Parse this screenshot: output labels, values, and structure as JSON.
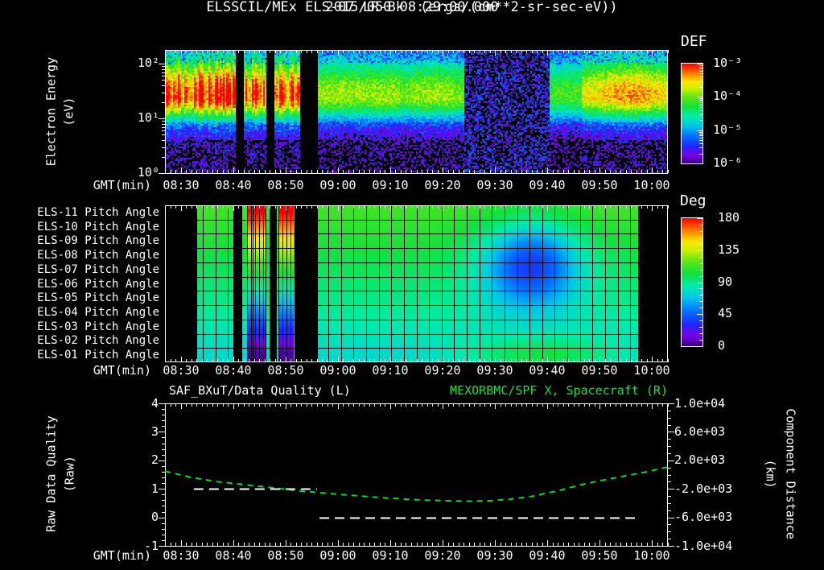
{
  "title": {
    "timestamp": "2015/050 08:29:00.000",
    "source": "ELSSCIL/MEx ELS-07 LR-Bk",
    "units": "(ergs/(cm**2-sr-sec-eV))"
  },
  "colors": {
    "background": "#000000",
    "text": "#ffffff",
    "accent_green": "#1ede3c",
    "tick": "#ffffff",
    "curve_green": "#00dd22",
    "quality_white": "#ffffff",
    "grid": "#000000"
  },
  "time_axis": {
    "label": "GMT(min)",
    "tick_labels": [
      "08:30",
      "08:40",
      "08:50",
      "09:00",
      "09:10",
      "09:20",
      "09:30",
      "09:40",
      "09:50",
      "10:00"
    ],
    "start": "08:27",
    "end": "10:03",
    "span_min": 96,
    "first_tick_min": 3,
    "tick_step_min": 10,
    "minor_step_min": 1
  },
  "spectrogram_panel": {
    "y_axis_label_line1": "Electron Energy",
    "y_axis_label_line2": "(eV)",
    "y_tick_labels": [
      "10²",
      "10¹",
      "10⁰"
    ],
    "y_tick_exponents": [
      2,
      1,
      0
    ],
    "colorbar": {
      "title": "DEF",
      "tick_labels": [
        "10⁻³",
        "10⁻⁴",
        "10⁻⁵",
        "10⁻⁶"
      ],
      "tick_exponents": [
        -3,
        -4,
        -5,
        -6
      ]
    }
  },
  "pitch_panel": {
    "row_labels": [
      "ELS-11 Pitch Angle",
      "ELS-10 Pitch Angle",
      "ELS-09 Pitch Angle",
      "ELS-08 Pitch Angle",
      "ELS-07 Pitch Angle",
      "ELS-06 Pitch Angle",
      "ELS-05 Pitch Angle",
      "ELS-04 Pitch Angle",
      "ELS-03 Pitch Angle",
      "ELS-02 Pitch Angle",
      "ELS-01 Pitch Angle"
    ],
    "colorbar": {
      "title": "Deg",
      "tick_labels": [
        "180",
        "135",
        "90",
        "45",
        "0"
      ],
      "tick_values": [
        180,
        135,
        90,
        45,
        0
      ]
    }
  },
  "bottom_panel": {
    "title_left": "SAF_BXuT/Data Quality (L)",
    "title_right": "MEXORBMC/SPF X, Spacecraft (R)",
    "y_left_label_line1": "Raw Data Quality",
    "y_left_label_line2": "(Raw)",
    "y_left_tick_labels": [
      "4",
      "3",
      "2",
      "1",
      "0",
      "-1"
    ],
    "y_left_tick_values": [
      4,
      3,
      2,
      1,
      0,
      -1
    ],
    "y_right_label_line1": "Component Distance",
    "y_right_label_line2": "(km)",
    "y_right_tick_labels": [
      "1.0e+04",
      "6.0e+03",
      "2.0e+03",
      "-2.0e+03",
      "-6.0e+03",
      "-1.0e+04"
    ]
  },
  "chart_data": [
    {
      "type": "heatmap",
      "name": "electron-energy-spectrogram",
      "title": "ELSSCIL/MEx ELS-07 LR-Bk",
      "x_unit": "minutes after 08:27:00 GMT",
      "x_range": [
        0,
        96
      ],
      "y_scale": "log10(eV)",
      "y_range_exp": [
        0,
        2.22
      ],
      "value_label": "DEF (ergs/(cm**2-sr-sec-eV))",
      "value_range_exp": [
        -6,
        -3
      ],
      "band_center_logev": 1.42,
      "band_sigma_below": 0.32,
      "band_sigma_above": 0.56,
      "segments": [
        {
          "t0": 0.0,
          "t1": 13.5,
          "amp": 0.97,
          "striated": true,
          "dark": false
        },
        {
          "t0": 15.0,
          "t1": 19.5,
          "amp": 0.95,
          "striated": true,
          "dark": false
        },
        {
          "t0": 21.0,
          "t1": 25.8,
          "amp": 0.9,
          "striated": true,
          "dark": false
        },
        {
          "t0": 29.2,
          "t1": 45.0,
          "amp": 0.66,
          "striated": false,
          "dark": false
        },
        {
          "t0": 45.0,
          "t1": 57.0,
          "amp": 0.58,
          "striated": false,
          "dark": false,
          "bump": {
            "t": 51,
            "sigma": 5,
            "amp": 0.08
          }
        },
        {
          "t0": 57.0,
          "t1": 73.5,
          "amp": 0.16,
          "striated": false,
          "dark": true
        },
        {
          "t0": 73.5,
          "t1": 79.5,
          "amp": 0.58,
          "striated": false,
          "dark": false
        },
        {
          "t0": 79.5,
          "t1": 96.0,
          "amp": 0.7,
          "striated": false,
          "dark": false,
          "bump": {
            "t": 89,
            "sigma": 5,
            "amp": 0.13
          }
        }
      ],
      "gaps_min": [
        [
          13.5,
          15.0
        ],
        [
          19.5,
          21.0
        ],
        [
          25.8,
          29.2
        ]
      ],
      "colormap": {
        "name": "rainbow",
        "stops": [
          [
            0,
            "#3c008c"
          ],
          [
            0.08,
            "#7800e6"
          ],
          [
            0.17,
            "#1e28ff"
          ],
          [
            0.28,
            "#0078ff"
          ],
          [
            0.38,
            "#00c8e6"
          ],
          [
            0.47,
            "#00ebaa"
          ],
          [
            0.57,
            "#14e13c"
          ],
          [
            0.66,
            "#5ae614"
          ],
          [
            0.75,
            "#c8f000"
          ],
          [
            0.82,
            "#ffe600"
          ],
          [
            0.9,
            "#ff8200"
          ],
          [
            1,
            "#ff0000"
          ]
        ]
      }
    },
    {
      "type": "heatmap",
      "name": "pitch-angle-grid",
      "rows": [
        "ELS-11",
        "ELS-10",
        "ELS-09",
        "ELS-08",
        "ELS-07",
        "ELS-06",
        "ELS-05",
        "ELS-04",
        "ELS-03",
        "ELS-02",
        "ELS-01"
      ],
      "x_unit": "minutes after 08:27:00 GMT",
      "x_range": [
        0,
        96
      ],
      "value_label": "Pitch angle (deg)",
      "value_range": [
        0,
        180
      ],
      "data_start_min": 6.1,
      "gaps_min": [
        [
          13.0,
          14.8
        ],
        [
          19.9,
          21.3
        ],
        [
          24.8,
          29.2
        ],
        [
          90.3,
          96.0
        ]
      ],
      "cell_minutes": 2.4,
      "base_angle_row0_deg": 112,
      "base_angle_step_per_row_deg": -3.6,
      "rainbow_columns_min": [
        [
          15.6,
          19.4
        ],
        [
          21.6,
          24.6
        ]
      ],
      "low_angle_blob": {
        "t_center": 70,
        "t_sigma": 6.5,
        "row_center": 3.6,
        "row_sigma": 2.1,
        "depth_deg": 64
      },
      "bottom_row_enhancement": {
        "t_center": 72,
        "t_sigma": 10,
        "row": 10,
        "amount_deg": 26
      }
    },
    {
      "type": "line",
      "name": "quality-and-spacecraft-x",
      "x_unit": "minutes after 08:27:00 GMT",
      "x_range": [
        0,
        96
      ],
      "y_left": {
        "label": "Raw Data Quality (Raw)",
        "range": [
          -1,
          4
        ]
      },
      "y_right": {
        "label": "Component Distance (km)",
        "range": [
          -10000,
          10000
        ]
      },
      "right_from_left": "km = (raw - 1.5) * 4000",
      "series": [
        {
          "name": "MEXORBMC/SPF X, Spacecraft (R)",
          "color": "#00dd22",
          "style": "dashed",
          "axis": "left-units",
          "points": [
            [
              0,
              1.62
            ],
            [
              5,
              1.4
            ],
            [
              10,
              1.25
            ],
            [
              15,
              1.15
            ],
            [
              20,
              1.05
            ],
            [
              25,
              0.94
            ],
            [
              30,
              0.86
            ],
            [
              35,
              0.78
            ],
            [
              40,
              0.71
            ],
            [
              45,
              0.645
            ],
            [
              50,
              0.6
            ],
            [
              55,
              0.578
            ],
            [
              58,
              0.57
            ],
            [
              62,
              0.58
            ],
            [
              66,
              0.64
            ],
            [
              70,
              0.74
            ],
            [
              75,
              0.93
            ],
            [
              80,
              1.17
            ],
            [
              84,
              1.32
            ],
            [
              88,
              1.46
            ],
            [
              92,
              1.6
            ],
            [
              96,
              1.77
            ]
          ]
        },
        {
          "name": "SAF_BXuT/Data Quality (L)",
          "color": "#ffffff",
          "style": "dashed",
          "segments": [
            {
              "value": 1,
              "t0": 5.5,
              "t1": 29.0
            },
            {
              "value": 0,
              "t0": 29.5,
              "t1": 90.3
            }
          ]
        }
      ]
    }
  ]
}
